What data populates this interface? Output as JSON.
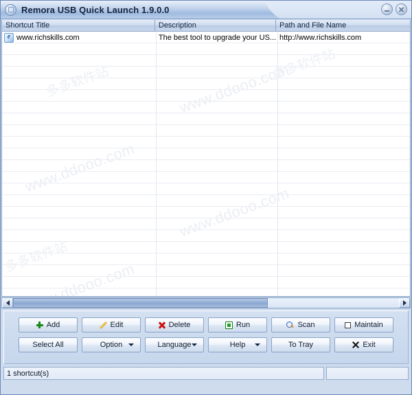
{
  "window": {
    "title": "Remora USB Quick Launch 1.9.0.0",
    "icon": "app-window-icon",
    "caption_buttons": [
      {
        "name": "minimize",
        "label": "Minimize"
      },
      {
        "name": "close",
        "label": "Close"
      }
    ]
  },
  "list": {
    "columns": [
      {
        "key": "title",
        "label": "Shortcut Title"
      },
      {
        "key": "description",
        "label": "Description"
      },
      {
        "key": "path",
        "label": "Path and File Name"
      }
    ],
    "rows": [
      {
        "icon": "internet-explorer-icon",
        "title": "www.richskills.com",
        "description": "The best tool to upgrade your US...",
        "path": "http://www.richskills.com"
      }
    ],
    "empty_row_count": 21
  },
  "scrollbar": {
    "left_arrow": "scroll-left",
    "right_arrow": "scroll-right",
    "thumb_width_percent": 66
  },
  "watermarks": [
    {
      "text": "www.ddooo.com"
    },
    {
      "text": "www.ddooo.com"
    },
    {
      "text": "www.ddooo.com"
    },
    {
      "text": "www.ddooo.com"
    },
    {
      "text": "多多软件站"
    },
    {
      "text": "多多软件站"
    },
    {
      "text": "多多软件站"
    }
  ],
  "buttons": {
    "row1": [
      {
        "name": "add",
        "label": "Add",
        "icon": "plus-icon",
        "dropdown": false
      },
      {
        "name": "edit",
        "label": "Edit",
        "icon": "pencil-icon",
        "dropdown": false
      },
      {
        "name": "delete",
        "label": "Delete",
        "icon": "x-red-icon",
        "dropdown": false
      },
      {
        "name": "run",
        "label": "Run",
        "icon": "run-app-icon",
        "dropdown": false
      },
      {
        "name": "scan",
        "label": "Scan",
        "icon": "magnifier-icon",
        "dropdown": false
      },
      {
        "name": "maintain",
        "label": "Maintain",
        "icon": "square-icon",
        "dropdown": false
      }
    ],
    "row2": [
      {
        "name": "select-all",
        "label": "Select All",
        "icon": null,
        "dropdown": false
      },
      {
        "name": "option",
        "label": "Option",
        "icon": null,
        "dropdown": true
      },
      {
        "name": "language",
        "label": "Language",
        "icon": null,
        "dropdown": true
      },
      {
        "name": "help",
        "label": "Help",
        "icon": null,
        "dropdown": true
      },
      {
        "name": "to-tray",
        "label": "To Tray",
        "icon": null,
        "dropdown": false
      },
      {
        "name": "exit",
        "label": "Exit",
        "icon": "x-black-icon",
        "dropdown": false
      }
    ]
  },
  "statusbar": {
    "main": "1 shortcut(s)",
    "extra": ""
  },
  "colors": {
    "title_gradient_top": "#e9f0fb",
    "title_gradient_bottom": "#9fbbe0",
    "panel_bg": "#cfdcee",
    "border": "#6b87b5",
    "accent_green": "#17a317",
    "accent_red": "#cc1111",
    "accent_orange": "#d8a21b",
    "accent_blue": "#2a63b8",
    "list_bg": "#ffffff",
    "watermark": "#eceef4"
  }
}
